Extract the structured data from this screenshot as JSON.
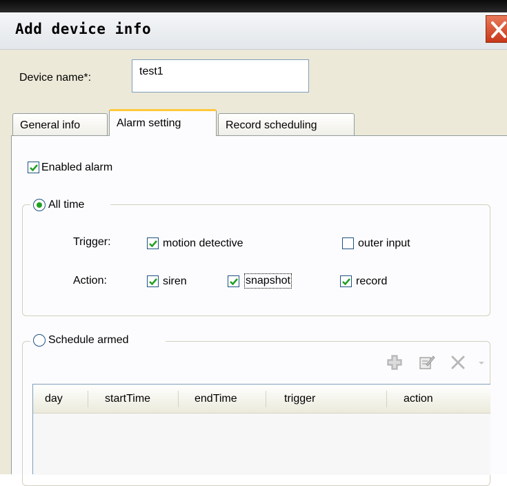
{
  "window": {
    "title": "Add device info",
    "close_icon": "close-icon"
  },
  "device": {
    "name_label": "Device name*:",
    "name_value": "test1"
  },
  "tabs": [
    {
      "label": "General info",
      "active": false
    },
    {
      "label": "Alarm setting",
      "active": true
    },
    {
      "label": "Record scheduling",
      "active": false
    }
  ],
  "alarm": {
    "enabled_label": "Enabled alarm",
    "enabled_checked": true,
    "all_time": {
      "label": "All time",
      "selected": true,
      "trigger_label": "Trigger:",
      "triggers": [
        {
          "label": "motion detective",
          "checked": true
        },
        {
          "label": "outer input",
          "checked": false
        }
      ],
      "action_label": "Action:",
      "actions": [
        {
          "label": "siren",
          "checked": true
        },
        {
          "label": "snapshot",
          "checked": true
        },
        {
          "label": "record",
          "checked": true
        }
      ]
    },
    "schedule": {
      "label": "Schedule armed",
      "selected": false,
      "toolbar": [
        "add-icon",
        "edit-icon",
        "delete-icon",
        "dropdown-arrow-icon"
      ],
      "columns": [
        "day",
        "startTime",
        "endTime",
        "trigger",
        "action"
      ],
      "rows": []
    }
  },
  "colors": {
    "dialog_bg": "#ece9d8",
    "panel_bg": "#fcfcfe",
    "active_tab_accent": "#ffc83c",
    "check_color": "#21a121",
    "close_button": "#d9532f"
  }
}
